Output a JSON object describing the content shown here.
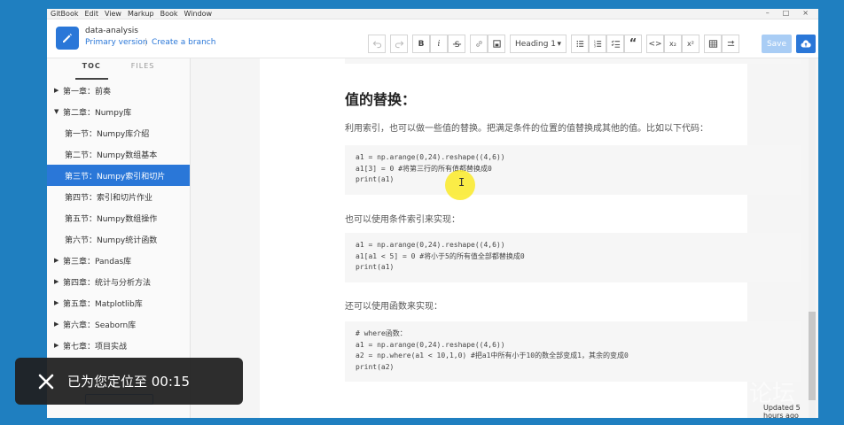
{
  "menubar": {
    "items": [
      "GitBook",
      "Edit",
      "View",
      "Markup",
      "Book",
      "Window"
    ]
  },
  "book": {
    "title": "data-analysis",
    "version": "Primary version",
    "create_branch": "Create a branch"
  },
  "toolbar": {
    "bold": "B",
    "italic": "i",
    "heading_select": "Heading 1",
    "quote": "“",
    "code": "<>",
    "subscript": "x₂",
    "superscript": "x²",
    "save": "Save"
  },
  "sidebar": {
    "tabs": [
      {
        "label": "TOC",
        "active": true
      },
      {
        "label": "FILES",
        "active": false
      }
    ],
    "items": [
      {
        "label": "第一章：前奏",
        "type": "chapter",
        "caret": "▶",
        "active": false
      },
      {
        "label": "第二章：Numpy库",
        "type": "chapter",
        "caret": "▼",
        "active": false
      },
      {
        "label": "第一节：Numpy库介绍",
        "type": "section",
        "caret": "",
        "active": false
      },
      {
        "label": "第二节：Numpy数组基本",
        "type": "section",
        "caret": "",
        "active": false
      },
      {
        "label": "第三节：Numpy索引和切片",
        "type": "section",
        "caret": "",
        "active": true
      },
      {
        "label": "第四节：索引和切片作业",
        "type": "section",
        "caret": "",
        "active": false
      },
      {
        "label": "第五节：Numpy数组操作",
        "type": "section",
        "caret": "",
        "active": false
      },
      {
        "label": "第六节：Numpy统计函数",
        "type": "section",
        "caret": "",
        "active": false
      },
      {
        "label": "第三章：Pandas库",
        "type": "chapter",
        "caret": "▶",
        "active": false
      },
      {
        "label": "第四章：统计与分析方法",
        "type": "chapter",
        "caret": "▶",
        "active": false
      },
      {
        "label": "第五章：Matplotlib库",
        "type": "chapter",
        "caret": "▶",
        "active": false
      },
      {
        "label": "第六章：Seaborn库",
        "type": "chapter",
        "caret": "▶",
        "active": false
      },
      {
        "label": "第七章：项目实战",
        "type": "chapter",
        "caret": "▶",
        "active": false
      }
    ]
  },
  "content": {
    "heading": "值的替换：",
    "para1": "利用索引，也可以做一些值的替换。把满足条件的位置的值替换成其他的值。比如以下代码：",
    "code1": [
      "a1 = np.arange(0,24).reshape((4,6))",
      "a1[3] = 0 #将第三行的所有值都替换成0",
      "print(a1)"
    ],
    "para2": "也可以使用条件索引来实现：",
    "code2": [
      "a1 = np.arange(0,24).reshape((4,6))",
      "a1[a1 < 5] = 0 #将小于5的所有值全部都替换成0",
      "print(a1)"
    ],
    "para3": "还可以使用函数来实现：",
    "code3": [
      "# where函数：",
      "a1 = np.arange(0,24).reshape((4,6))",
      "a2 = np.where(a1 < 10,1,0) #把a1中所有小于10的数全部变成1，其余的变成0",
      "print(a2)"
    ]
  },
  "footer": {
    "updated": "Updated 5 hours ago",
    "help": "?"
  },
  "toast": {
    "text": "已为您定位至 00:15"
  },
  "colors": {
    "accent": "#2a77d8",
    "frame_blue": "#1f7fc0",
    "cursor_highlight": "#faea28"
  }
}
